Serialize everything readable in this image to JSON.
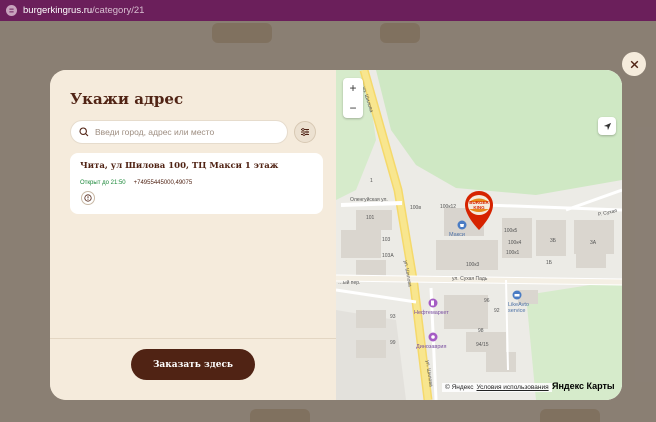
{
  "browser": {
    "url_host": "burgerkingrus.ru",
    "url_path": "/category/21"
  },
  "modal": {
    "title": "Укажи адрес",
    "search": {
      "placeholder": "Введи город, адрес или место",
      "value": ""
    },
    "restaurant": {
      "name": "Чита, ул Шилова 100, ТЦ Макси 1 этаж",
      "status": "Открыт до 21:50",
      "phone": "+74955445000,49075"
    },
    "order_button": "Заказать здесь"
  },
  "map": {
    "zoom_in": "+",
    "zoom_out": "−",
    "streets": {
      "shilova_top": "ул. Шилова",
      "shilova_mid": "ул. Шилова",
      "shilova_bottom": "ул. Шилова",
      "olengui": "Оленгуйская ул.",
      "sukhaya_pad": "ул. Сухая Падь",
      "sukhaya_pad_right": "Р. Сухая",
      "lane": "…ый пер."
    },
    "buildings": [
      "100в",
      "100к12",
      "100к5",
      "100к1",
      "100к4",
      "100к3",
      "1Б",
      "3Б",
      "3А",
      "1",
      "101",
      "103",
      "103А",
      "93",
      "99",
      "92",
      "94/15",
      "96",
      "98"
    ],
    "pois": {
      "maxi": "Макси",
      "likeavto": "LikeAvto\nservice",
      "neftemarket": "Нефтемаркет",
      "dinozavria": "Динозаврия"
    },
    "pin_label": "BURGER KING",
    "copyright": "© Яндекс",
    "terms": "Условия использования",
    "logo": "Яндекс Карты"
  },
  "colors": {
    "brand_brown": "#502314",
    "cream": "#f5ebdc",
    "open_green": "#198737",
    "bk_red": "#d62300"
  }
}
